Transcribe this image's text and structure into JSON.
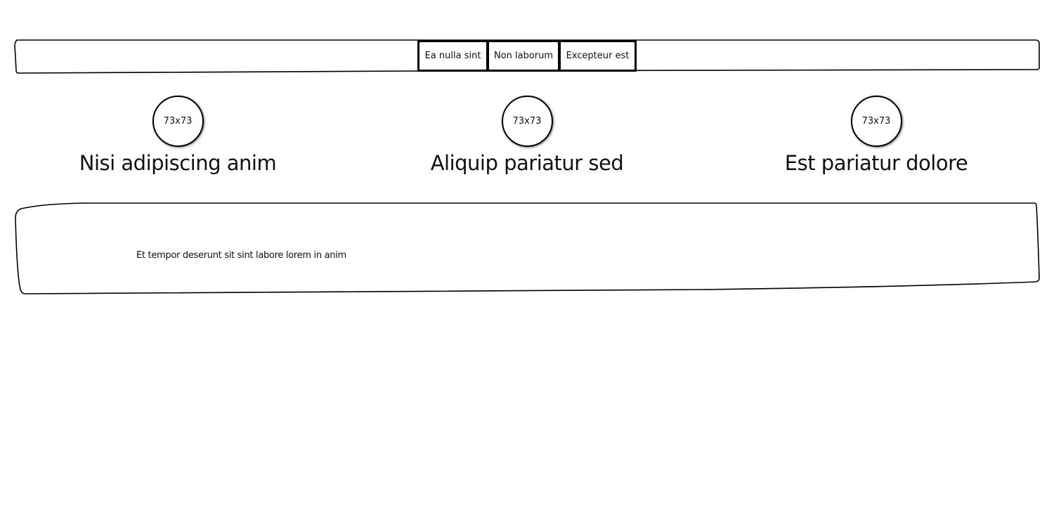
{
  "nav": {
    "items": [
      {
        "label": "Ea nulla sint"
      },
      {
        "label": "Non laborum"
      },
      {
        "label": "Excepteur est"
      }
    ]
  },
  "features": [
    {
      "image_label": "73x73",
      "title": "Nisi adipiscing anim"
    },
    {
      "image_label": "73x73",
      "title": "Aliquip pariatur sed"
    },
    {
      "image_label": "73x73",
      "title": "Est pariatur dolore"
    }
  ],
  "content": {
    "text": "Et tempor deserunt sit sint labore lorem in anim"
  }
}
